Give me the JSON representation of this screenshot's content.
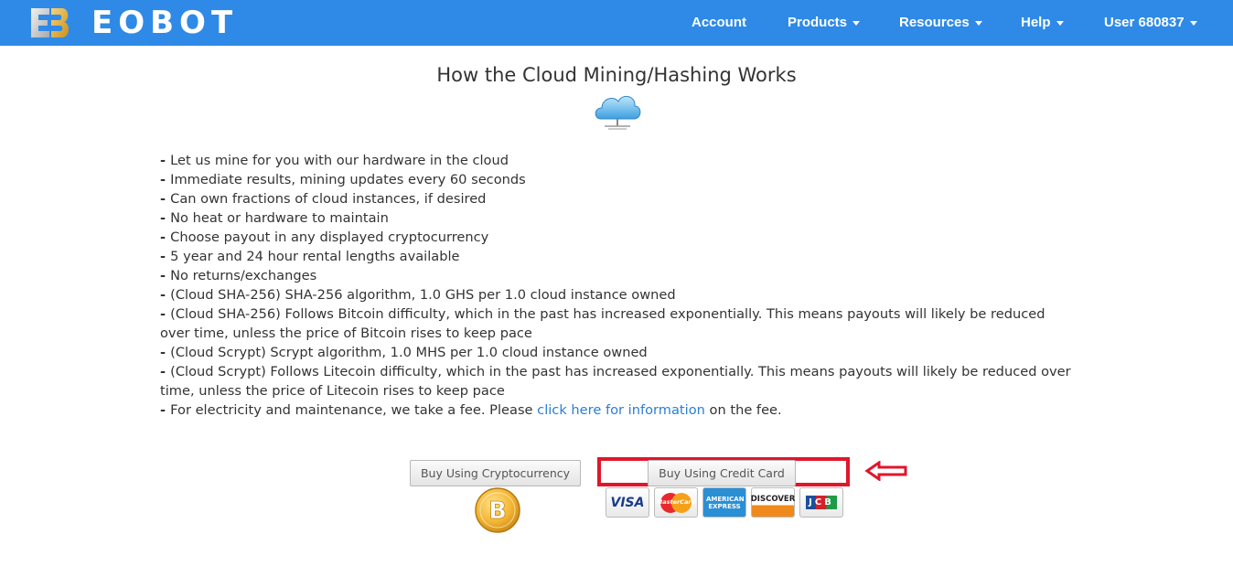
{
  "navbar": {
    "brand": "EOBOT",
    "items": [
      {
        "label": "Account",
        "dropdown": false
      },
      {
        "label": "Products",
        "dropdown": true
      },
      {
        "label": "Resources",
        "dropdown": true
      },
      {
        "label": "Help",
        "dropdown": true
      },
      {
        "label": "User 680837",
        "dropdown": true
      }
    ],
    "bg_color": "#2e8ae6"
  },
  "main": {
    "title": "How the Cloud Mining/Hashing Works",
    "bullets": [
      "Let us mine for you with our hardware in the cloud",
      "Immediate results, mining updates every 60 seconds",
      "Can own fractions of cloud instances, if desired",
      "No heat or hardware to maintain",
      "Choose payout in any displayed cryptocurrency",
      "5 year and 24 hour rental lengths available",
      "No returns/exchanges",
      "(Cloud SHA-256) SHA-256 algorithm, 1.0 GHS per 1.0 cloud instance owned",
      "(Cloud SHA-256) Follows Bitcoin difficulty, which in the past has increased exponentially. This means payouts will likely be reduced over time, unless the price of Bitcoin rises to keep pace",
      "(Cloud Scrypt) Scrypt algorithm, 1.0 MHS per 1.0 cloud instance owned",
      "(Cloud Scrypt) Follows Litecoin difficulty, which in the past has increased exponentially. This means payouts will likely be reduced over time, unless the price of Litecoin rises to keep pace"
    ],
    "fee_line": {
      "prefix": "For electricity and maintenance, we take a fee. Please",
      "link": "click here for information",
      "suffix": "on the fee."
    }
  },
  "payment": {
    "crypto_button": "Buy Using Cryptocurrency",
    "card_button": "Buy Using Credit Card",
    "cards": [
      "VISA",
      "MasterCard",
      "AMERICAN EXPRESS",
      "DISCOVER",
      "JCB"
    ],
    "bitcoin_symbol": "B",
    "highlight_color": "#e0162b"
  }
}
